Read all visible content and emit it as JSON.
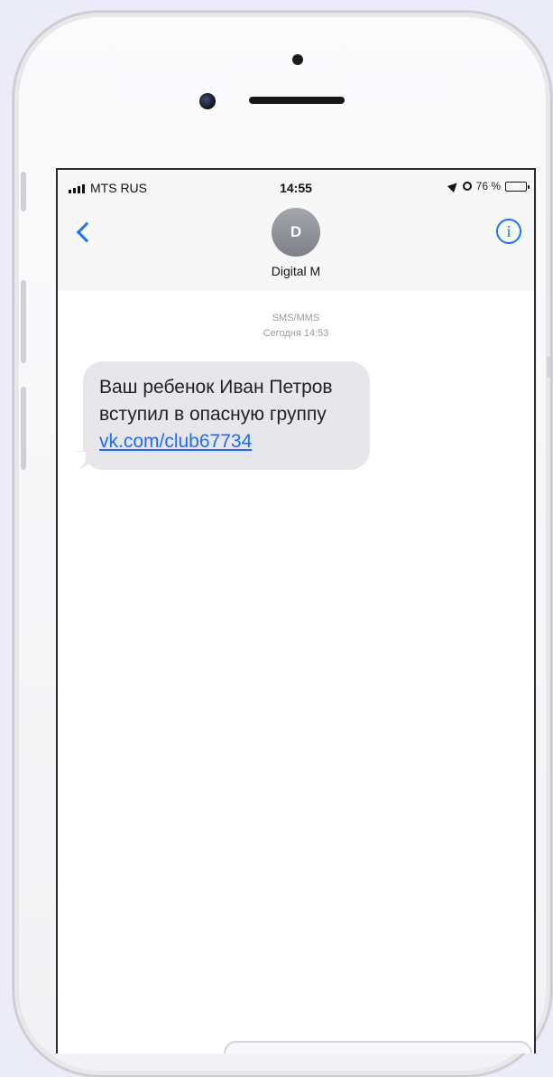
{
  "status_bar": {
    "carrier": "MTS RUS",
    "time": "14:55",
    "battery_percent": "76 %",
    "battery_level": 0.76
  },
  "header": {
    "avatar_initial": "D",
    "contact_name": "Digital M"
  },
  "conversation": {
    "service": "SMS/MMS",
    "date": "Сегодня 14:53",
    "message_line_1": "Ваш ребенок Иван Петров",
    "message_line_2": "вступил в опасную группу",
    "message_link": "vk.com/club67734"
  },
  "icons": {
    "back": "chevron-left-icon",
    "info": "info-icon",
    "signal": "signal-strength-icon",
    "location": "location-icon",
    "alarm": "alarm-icon",
    "battery": "battery-icon"
  },
  "colors": {
    "accent": "#1478ff",
    "bubble": "#e6e6eb",
    "background": "#ecebf8"
  }
}
